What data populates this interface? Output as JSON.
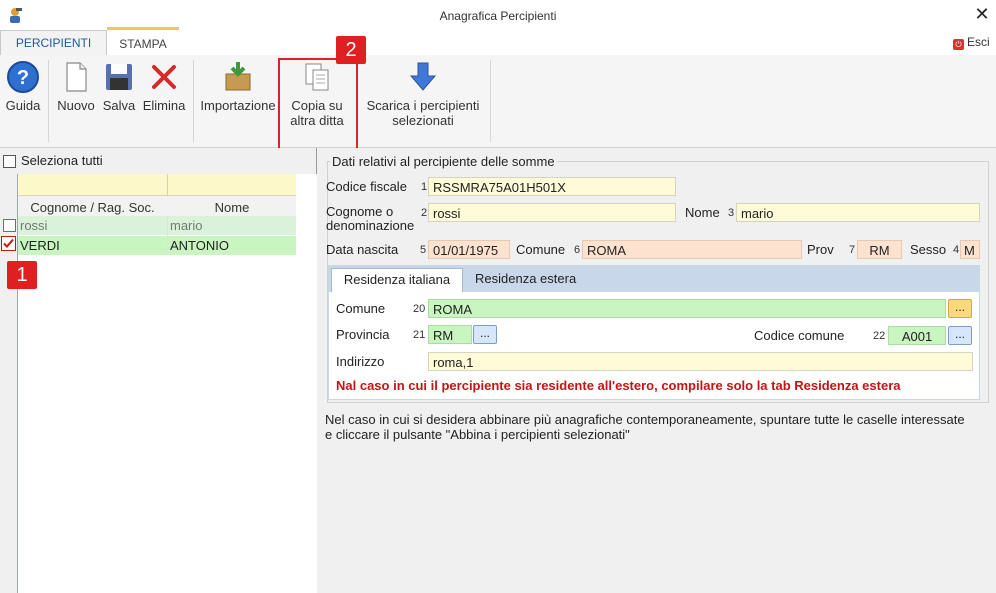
{
  "window": {
    "title": "Anagrafica Percipienti"
  },
  "ribbon_tabs": [
    {
      "label": "PERCIPIENTI"
    },
    {
      "label": "STAMPA"
    }
  ],
  "exit": {
    "label": "Esci"
  },
  "toolbar": {
    "guida": "Guida",
    "nuovo": "Nuovo",
    "salva": "Salva",
    "elimina": "Elimina",
    "importazione": "Importazione",
    "copia_line1": "Copia su",
    "copia_line2": "altra ditta",
    "scarica_line1": "Scarica i percipienti",
    "scarica_line2": "selezionati"
  },
  "callouts": {
    "one": "1",
    "two": "2"
  },
  "list": {
    "select_all": "Seleziona tutti",
    "columns": [
      "Cognome / Rag. Soc.",
      "Nome"
    ],
    "rows": [
      {
        "cognome": "rossi",
        "nome": "mario",
        "checked": false
      },
      {
        "cognome": "VERDI",
        "nome": "ANTONIO",
        "checked": true
      }
    ]
  },
  "form": {
    "group_title": "Dati relativi al percipiente delle somme",
    "codice_fiscale": {
      "label": "Codice fiscale",
      "num": "1",
      "value": "RSSMRA75A01H501X"
    },
    "cognome": {
      "label_line1": "Cognome o",
      "label_line2": "denominazione",
      "num": "2",
      "value": "rossi"
    },
    "nome": {
      "label": "Nome",
      "num": "3",
      "value": "mario"
    },
    "data_nascita": {
      "label": "Data nascita",
      "num": "5",
      "value": "01/01/1975"
    },
    "comune_nascita": {
      "label": "Comune",
      "num": "6",
      "value": "ROMA"
    },
    "prov": {
      "label": "Prov",
      "num": "7",
      "value": "RM"
    },
    "sesso": {
      "label": "Sesso",
      "num": "4",
      "value": "M"
    },
    "tabs": [
      "Residenza italiana",
      "Residenza estera"
    ],
    "residenza": {
      "comune": {
        "label": "Comune",
        "num": "20",
        "value": "ROMA"
      },
      "provincia": {
        "label": "Provincia",
        "num": "21",
        "value": "RM"
      },
      "codice_comune": {
        "label": "Codice comune",
        "num": "22",
        "value": "A001"
      },
      "indirizzo": {
        "label": "Indirizzo",
        "value": "roma,1"
      },
      "dots": "..."
    },
    "warning": "Nal caso in cui il percipiente sia residente all'estero, compilare solo la tab Residenza estera"
  },
  "note": "Nel caso in cui si desidera abbinare più anagrafiche contemporaneamente, spuntare tutte le caselle interessate e cliccare il pulsante \"Abbina i percipienti selezionati\"",
  "colors": {
    "accent_red": "#e02020",
    "tab_blue": "#1c5aa0",
    "field_yellow": "#fdfbd8",
    "field_green": "#c8f5c0",
    "field_orange": "#fde3cf"
  }
}
